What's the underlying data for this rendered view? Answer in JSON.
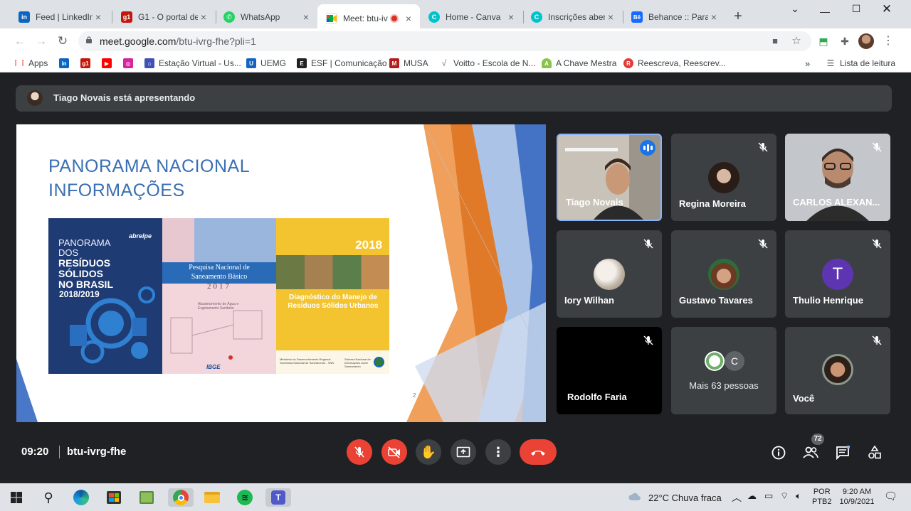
{
  "browser": {
    "tabs": [
      {
        "label": "Feed | LinkedIn",
        "favicon": "linkedin-icon",
        "color": "#0a66c2",
        "glyph": "in"
      },
      {
        "label": "G1 - O portal de",
        "favicon": "g1-icon",
        "color": "#c4170c",
        "glyph": "g1"
      },
      {
        "label": "WhatsApp",
        "favicon": "whatsapp-icon",
        "color": "#25d366",
        "glyph": "✆"
      },
      {
        "label": "Meet: btu-iv",
        "favicon": "meet-icon",
        "color": "#00897b",
        "glyph": "▶",
        "active": true
      },
      {
        "label": "Home - Canva",
        "favicon": "canva-icon",
        "color": "#00c4cc",
        "glyph": "C"
      },
      {
        "label": "Inscrições aberta",
        "favicon": "canva-icon",
        "color": "#00c4cc",
        "glyph": "C"
      },
      {
        "label": "Behance :: Para v",
        "favicon": "behance-icon",
        "color": "#1769ff",
        "glyph": "Bē"
      }
    ],
    "url_host": "meet.google.com",
    "url_rest": "/btu-ivrg-fhe?pli=1",
    "bookmarks": [
      {
        "label": "Apps",
        "icon": "apps-grid-icon",
        "color": "#ea4335",
        "glyph": "⋮⋮"
      },
      {
        "label": "",
        "icon": "linkedin-icon",
        "color": "#0a66c2",
        "glyph": "in"
      },
      {
        "label": "",
        "icon": "g1-icon",
        "color": "#c4170c",
        "glyph": "g1"
      },
      {
        "label": "",
        "icon": "youtube-icon",
        "color": "#ff0000",
        "glyph": "▶"
      },
      {
        "label": "",
        "icon": "instagram-icon",
        "color": "#d6249f",
        "glyph": "◎"
      },
      {
        "label": "Estação Virtual - Us...",
        "icon": "estacao-icon",
        "color": "#3f51b5",
        "glyph": "⌂"
      },
      {
        "label": "UEMG",
        "icon": "uemg-icon",
        "color": "#1565c0",
        "glyph": "U"
      },
      {
        "label": "ESF | Comunicação",
        "icon": "esf-icon",
        "color": "#222222",
        "glyph": "E"
      },
      {
        "label": "MUSA",
        "icon": "musa-icon",
        "color": "#b71c1c",
        "glyph": "M"
      },
      {
        "label": "Voitto - Escola de N...",
        "icon": "voitto-icon",
        "color": "#9e9e9e",
        "glyph": "√"
      },
      {
        "label": "A Chave Mestra",
        "icon": "android-icon",
        "color": "#8bc34a",
        "glyph": "A"
      },
      {
        "label": "Reescreva, Reescrev...",
        "icon": "reescreva-icon",
        "color": "#e53935",
        "glyph": "R"
      }
    ],
    "reading_list": "Lista de leitura"
  },
  "meet": {
    "presenter_text": "Tiago Novais está apresentando",
    "slide": {
      "title_line1": "PANORAMA NACIONAL",
      "title_line2": "INFORMAÇÕES",
      "page_number": "2",
      "cover1": {
        "line1": "PANORAMA",
        "line2": "DOS",
        "line3": "RESÍDUOS",
        "line4": "SÓLIDOS",
        "line5": "NO BRASIL",
        "year": "2018/2019",
        "brand": "abrelpe"
      },
      "cover2": {
        "title_line1": "Pesquisa Nacional de",
        "title_line2": "Saneamento Básico",
        "year": "2017",
        "subtitle_line1": "Abastecimento de Água e",
        "subtitle_line2": "Esgotamento Sanitário",
        "brand": "IBGE"
      },
      "cover3": {
        "year": "2018",
        "title_line1": "Diagnóstico do Manejo de",
        "title_line2": "Resíduos Sólidos Urbanos",
        "foot_left_line1": "Ministério do Desenvolvimento Regional",
        "foot_left_line2": "Secretaria Nacional de Saneamento - SNS",
        "foot_right_line1": "Sistema Nacional de",
        "foot_right_line2": "Informações sobre",
        "foot_right_line3": "Saneamento"
      }
    },
    "participants": [
      {
        "name": "Tiago Novais",
        "kind": "video",
        "speaking": true
      },
      {
        "name": "Regina Moreira",
        "kind": "avatar",
        "muted": true
      },
      {
        "name": "CARLOS ALEXAN...",
        "kind": "video",
        "muted": true
      },
      {
        "name": "Iory Wilhan",
        "kind": "avatar",
        "muted": true
      },
      {
        "name": "Gustavo Tavares",
        "kind": "avatar",
        "muted": true
      },
      {
        "name": "Thulio Henrique",
        "kind": "letter",
        "letter": "T",
        "color": "#5e35b1",
        "muted": true
      },
      {
        "name": "Rodolfo Faria",
        "kind": "black",
        "muted": true
      },
      {
        "name": "",
        "kind": "more",
        "more_letter": "C",
        "more_text": "Mais 63 pessoas"
      },
      {
        "name": "Você",
        "kind": "avatar",
        "muted": true
      }
    ],
    "time": "09:20",
    "meeting_code": "btu-ivrg-fhe",
    "people_count": "72",
    "colors": {
      "red": "#ea4335",
      "control_gray": "#3c4043",
      "accent_blue": "#1a73e8"
    }
  },
  "taskbar": {
    "weather": "22°C  Chuva fraca",
    "language_line1": "POR",
    "language_line2": "PTB2",
    "clock_time": "9:20 AM",
    "clock_date": "10/9/2021"
  }
}
